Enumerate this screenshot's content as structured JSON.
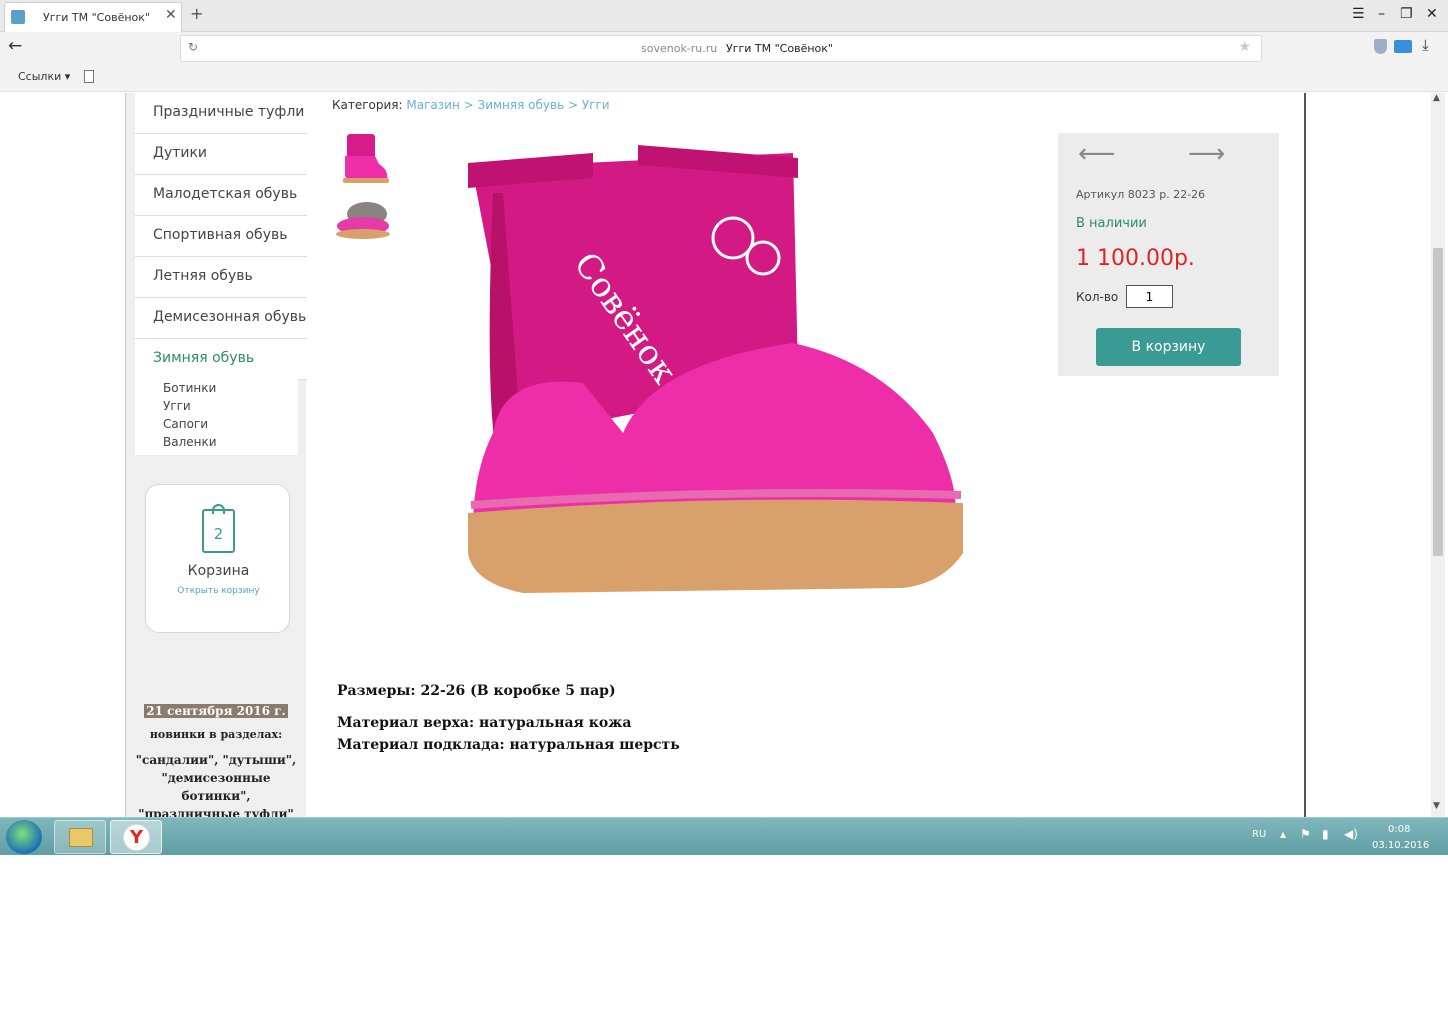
{
  "browser": {
    "tab_title": "Угги ТМ \"Совёнок\"",
    "tab_close": "✕",
    "new_tab": "+",
    "window_controls": [
      "☰",
      "–",
      "❐",
      "✕"
    ],
    "back": "←",
    "url_host": "sovenok-ru.ru",
    "url_title": "Угги ТМ \"Совёнок\"",
    "bookmarks_label": "Ссылки ▾"
  },
  "sidebar": {
    "categories": [
      {
        "label": "Праздничные туфли",
        "active": false
      },
      {
        "label": "Дутики",
        "active": false
      },
      {
        "label": "Малодетская обувь",
        "active": false
      },
      {
        "label": "Спортивная обувь",
        "active": false
      },
      {
        "label": "Летняя обувь",
        "active": false
      },
      {
        "label": "Демисезонная обувь",
        "active": false
      },
      {
        "label": "Зимняя обувь",
        "active": true
      }
    ],
    "subcategories": [
      "Ботинки",
      "Угги",
      "Сапоги",
      "Валенки"
    ],
    "cart": {
      "count": "2",
      "label": "Корзина",
      "open_link": "Открыть корзину"
    },
    "news": {
      "date": "21 сентября 2016 г.",
      "line1": "новинки в разделах:",
      "line2": "\"сандалии\", \"дутыши\", \"демисезонные ботинки\", \"праздничные туфли\""
    }
  },
  "breadcrumb": {
    "prefix": "Категория:",
    "items": [
      "Магазин",
      "Зимняя обувь",
      "Угги"
    ],
    "separator": ">"
  },
  "product": {
    "photo_text": "Совёнок",
    "sku": "Артикул 8023 р. 22-26",
    "stock": "В наличии",
    "price": "1 100.00р.",
    "qty_label": "Кол-во",
    "qty_value": "1",
    "add_to_cart": "В корзину",
    "prev_arrow": "⟵",
    "next_arrow": "⟶",
    "sizes": "Размеры: 22-26 (В коробке 5 пар)",
    "material_top": "Материал верха: натуральная кожа",
    "material_lining": "Материал подклада: натуральная шерсть"
  },
  "taskbar": {
    "lang": "RU",
    "time": "0:08",
    "date": "03.10.2016",
    "yandex_letter": "Y"
  },
  "colors": {
    "accent_teal": "#3a9a94",
    "price_red": "#e02424",
    "stock_green": "#2e8b6a",
    "link_blue": "#6ab0d8",
    "boot_pink": "#e8189a"
  }
}
